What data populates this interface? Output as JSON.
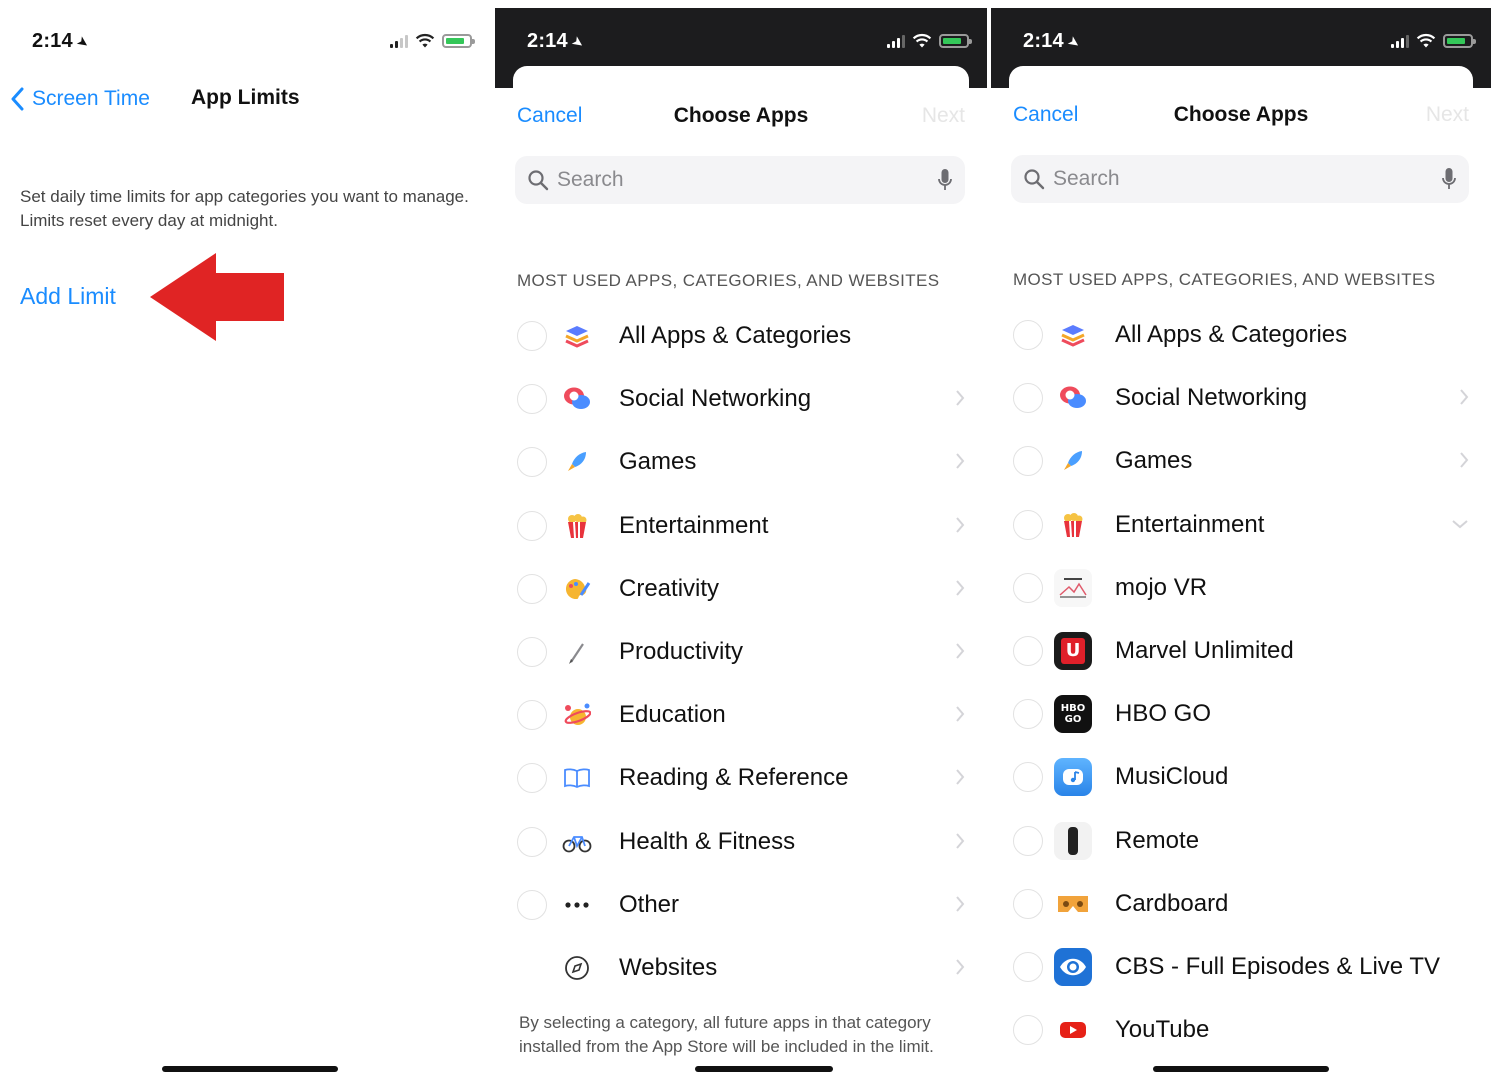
{
  "status_bar": {
    "time": "2:14"
  },
  "panel1": {
    "back_label": "Screen Time",
    "title": "App Limits",
    "description": "Set daily time limits for app categories you want to manage. Limits reset every day at midnight.",
    "add_limit": "Add Limit",
    "arrow_color": "#e02424"
  },
  "panel2": {
    "cancel": "Cancel",
    "title": "Choose Apps",
    "next": "Next",
    "search_placeholder": "Search",
    "section_header": "MOST USED APPS, CATEGORIES, AND WEBSITES",
    "rows": [
      {
        "label": "All Apps & Categories",
        "icon": "stack-icon"
      },
      {
        "label": "Social Networking",
        "icon": "chat-bubbles-icon"
      },
      {
        "label": "Games",
        "icon": "rocket-icon"
      },
      {
        "label": "Entertainment",
        "icon": "popcorn-icon"
      },
      {
        "label": "Creativity",
        "icon": "palette-icon"
      },
      {
        "label": "Productivity",
        "icon": "pencil-icon"
      },
      {
        "label": "Education",
        "icon": "globe-icon"
      },
      {
        "label": "Reading & Reference",
        "icon": "book-icon"
      },
      {
        "label": "Health & Fitness",
        "icon": "bicycle-icon"
      },
      {
        "label": "Other",
        "icon": "ellipsis-icon"
      },
      {
        "label": "Websites",
        "icon": "compass-icon"
      }
    ],
    "footer": "By selecting a category, all future apps in that category installed from the App Store will be included in the limit."
  },
  "panel3": {
    "cancel": "Cancel",
    "title": "Choose Apps",
    "next": "Next",
    "search_placeholder": "Search",
    "section_header": "MOST USED APPS, CATEGORIES, AND WEBSITES",
    "rows": [
      {
        "label": "All Apps & Categories",
        "icon": "stack-icon"
      },
      {
        "label": "Social Networking",
        "icon": "chat-bubbles-icon"
      },
      {
        "label": "Games",
        "icon": "rocket-icon"
      },
      {
        "label": "Entertainment",
        "icon": "popcorn-icon"
      },
      {
        "label": "mojo VR",
        "icon": "mojo-vr-app-icon"
      },
      {
        "label": "Marvel Unlimited",
        "icon": "marvel-unlimited-app-icon"
      },
      {
        "label": "HBO GO",
        "icon": "hbo-go-app-icon"
      },
      {
        "label": "MusiCloud",
        "icon": "musicloud-app-icon"
      },
      {
        "label": "Remote",
        "icon": "remote-app-icon"
      },
      {
        "label": "Cardboard",
        "icon": "cardboard-app-icon"
      },
      {
        "label": "CBS - Full Episodes & Live TV",
        "icon": "cbs-app-icon"
      },
      {
        "label": "YouTube",
        "icon": "youtube-app-icon"
      }
    ],
    "app_icon_text": {
      "marvel": "U",
      "hbo": "HBO GO"
    }
  },
  "colors": {
    "accent_blue": "#1a8cff",
    "arrow_red": "#e02424",
    "battery_green": "#34c759"
  }
}
